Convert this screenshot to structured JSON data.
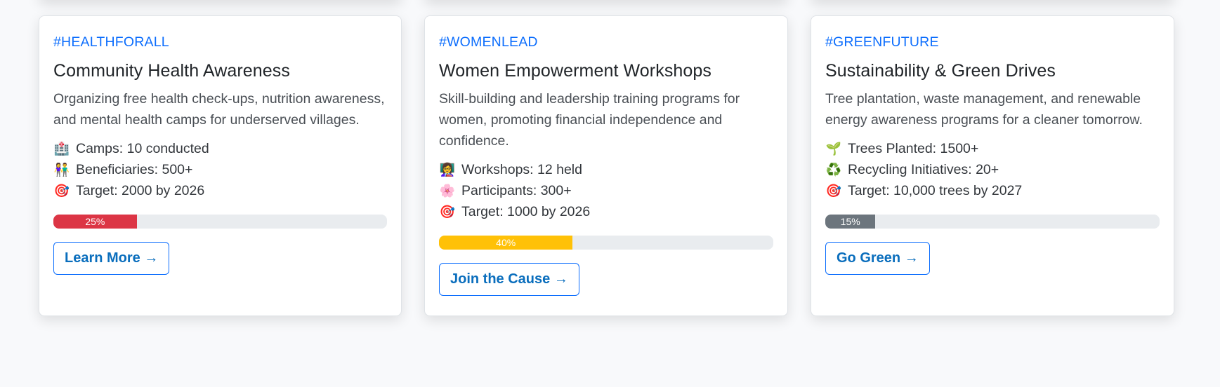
{
  "cards": [
    {
      "tag": "#HEALTHFORALL",
      "title": "Community Health Awareness",
      "description": "Organizing free health check-ups, nutrition awareness, and mental health camps for underserved villages.",
      "stats": [
        {
          "icon": "hospital-icon",
          "glyph": "🏥",
          "text": "Camps: 10 conducted"
        },
        {
          "icon": "people-icon",
          "glyph": "👫",
          "text": "Beneficiaries: 500+"
        },
        {
          "icon": "target-icon",
          "glyph": "🎯",
          "text": "Target: 2000 by 2026"
        }
      ],
      "progress": {
        "value": 25,
        "label": "25%",
        "color": "#dc3545"
      },
      "button": "Learn More →"
    },
    {
      "tag": "#WOMENLEAD",
      "title": "Women Empowerment Workshops",
      "description": "Skill-building and leadership training programs for women, promoting financial independence and confidence.",
      "stats": [
        {
          "icon": "teacher-icon",
          "glyph": "👩‍🏫",
          "text": "Workshops: 12 held"
        },
        {
          "icon": "flower-icon",
          "glyph": "🌸",
          "text": "Participants: 300+"
        },
        {
          "icon": "target-icon",
          "glyph": "🎯",
          "text": "Target: 1000 by 2026"
        }
      ],
      "progress": {
        "value": 40,
        "label": "40%",
        "color": "#ffc107"
      },
      "button": "Join the Cause →"
    },
    {
      "tag": "#GREENFUTURE",
      "title": "Sustainability & Green Drives",
      "description": "Tree plantation, waste management, and renewable energy awareness programs for a cleaner tomorrow.",
      "stats": [
        {
          "icon": "seedling-icon",
          "glyph": "🌱",
          "text": "Trees Planted: 1500+"
        },
        {
          "icon": "recycle-icon",
          "glyph": "♻️",
          "text": "Recycling Initiatives: 20+"
        },
        {
          "icon": "target-icon",
          "glyph": "🎯",
          "text": "Target: 10,000 trees by 2027"
        }
      ],
      "progress": {
        "value": 15,
        "label": "15%",
        "color": "#6c757d"
      },
      "button": "Go Green →"
    }
  ]
}
